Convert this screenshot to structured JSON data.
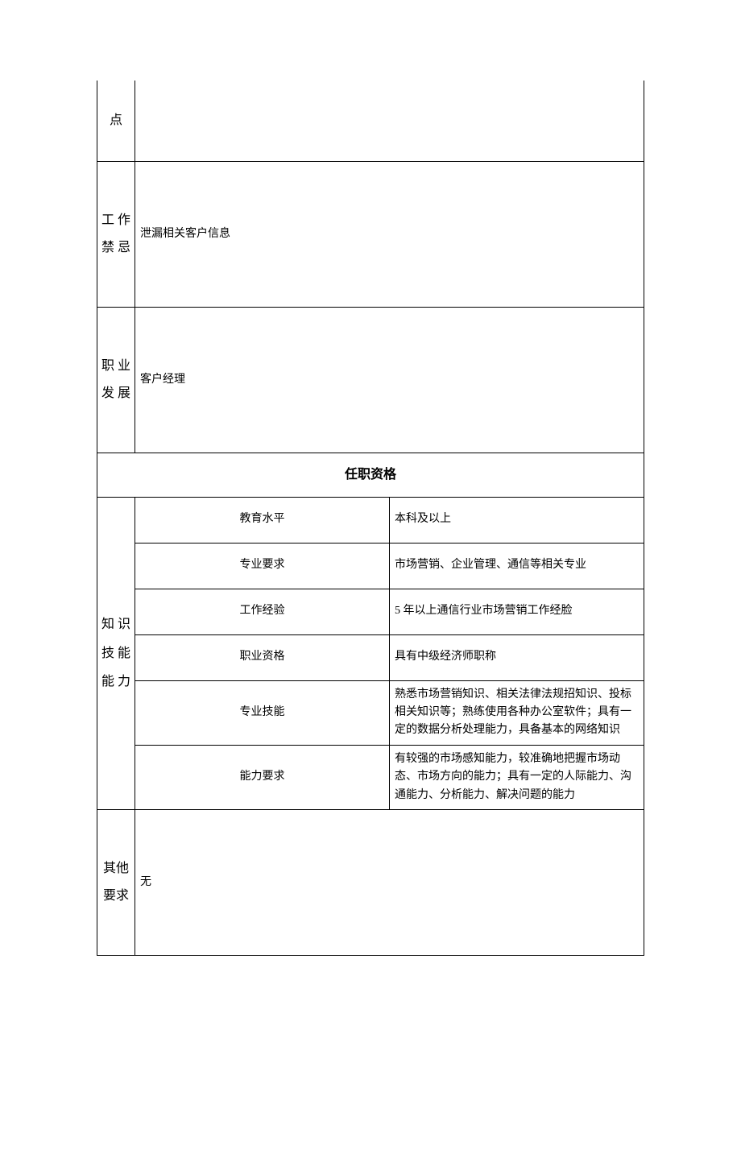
{
  "rows": {
    "key_points": {
      "label": "点",
      "value": ""
    },
    "taboo": {
      "label": "工 作禁 忌",
      "value": "泄漏相关客户信息"
    },
    "career": {
      "label": "职 业 发 展",
      "value": "客户经理"
    }
  },
  "qualification_header": "任职资格",
  "knowledge_label": "知 识 技 能 能 力",
  "qualifications": {
    "education": {
      "label": "教育水平",
      "value": "本科及以上"
    },
    "major": {
      "label": "专业要求",
      "value": "市场营销、企业管理、通信等相关专业"
    },
    "experience": {
      "label": "工作经验",
      "value": "5 年以上通信行业市场营销工作经脸"
    },
    "cert": {
      "label": "职业资格",
      "value": "具有中级经济师职称"
    },
    "skill": {
      "label": "专业技能",
      "value": "熟悉市场营销知识、相关法律法规招知识、投标相关知识等；熟练使用各种办公室软件；具有一定的数据分析处理能力，具备基本的网络知识"
    },
    "ability": {
      "label": "能力要求",
      "value": "有较强的市场感知能力，较准确地把握市场动态、市场方向的能力；具有一定的人际能力、沟通能力、分析能力、解决问题的能力"
    }
  },
  "other": {
    "label": "其他 要求",
    "value": "无"
  }
}
